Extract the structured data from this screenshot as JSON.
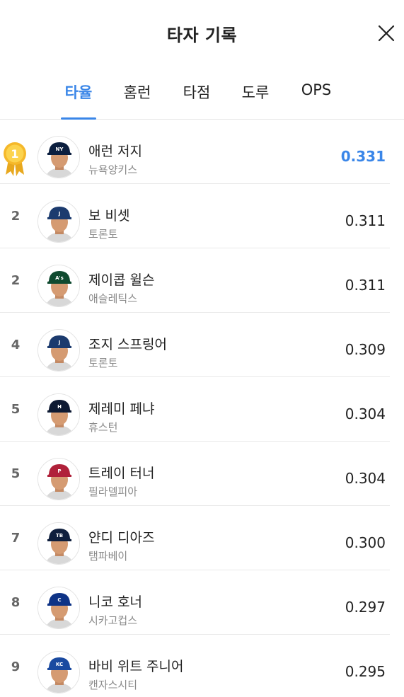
{
  "header": {
    "title": "타자 기록"
  },
  "tabs": [
    {
      "label": "타율",
      "active": true
    },
    {
      "label": "홈런",
      "active": false
    },
    {
      "label": "타점",
      "active": false
    },
    {
      "label": "도루",
      "active": false
    },
    {
      "label": "OPS",
      "active": false
    }
  ],
  "accent_color": "#3a86e8",
  "players": [
    {
      "rank": "1",
      "name": "애런 저지",
      "team": "뉴욕양키스",
      "value": "0.331",
      "cap_color": "#0c1f3f",
      "logo": "NY"
    },
    {
      "rank": "2",
      "name": "보 비셋",
      "team": "토론토",
      "value": "0.311",
      "cap_color": "#1c3b6e",
      "logo": "J"
    },
    {
      "rank": "2",
      "name": "제이콥 윌슨",
      "team": "애슬레틱스",
      "value": "0.311",
      "cap_color": "#0f4a2f",
      "logo": "A's"
    },
    {
      "rank": "4",
      "name": "조지 스프링어",
      "team": "토론토",
      "value": "0.309",
      "cap_color": "#1c3b6e",
      "logo": "J"
    },
    {
      "rank": "5",
      "name": "제레미 페냐",
      "team": "휴스턴",
      "value": "0.304",
      "cap_color": "#0e1a33",
      "logo": "H"
    },
    {
      "rank": "5",
      "name": "트레이 터너",
      "team": "필라델피아",
      "value": "0.304",
      "cap_color": "#b0213a",
      "logo": "P"
    },
    {
      "rank": "7",
      "name": "얀디 디아즈",
      "team": "탬파베이",
      "value": "0.300",
      "cap_color": "#0f1f3d",
      "logo": "TB"
    },
    {
      "rank": "8",
      "name": "니코 호너",
      "team": "시카고컵스",
      "value": "0.297",
      "cap_color": "#0e3386",
      "logo": "C"
    },
    {
      "rank": "9",
      "name": "바비 위트 주니어",
      "team": "캔자스시티",
      "value": "0.295",
      "cap_color": "#1a4aa0",
      "logo": "KC"
    }
  ]
}
